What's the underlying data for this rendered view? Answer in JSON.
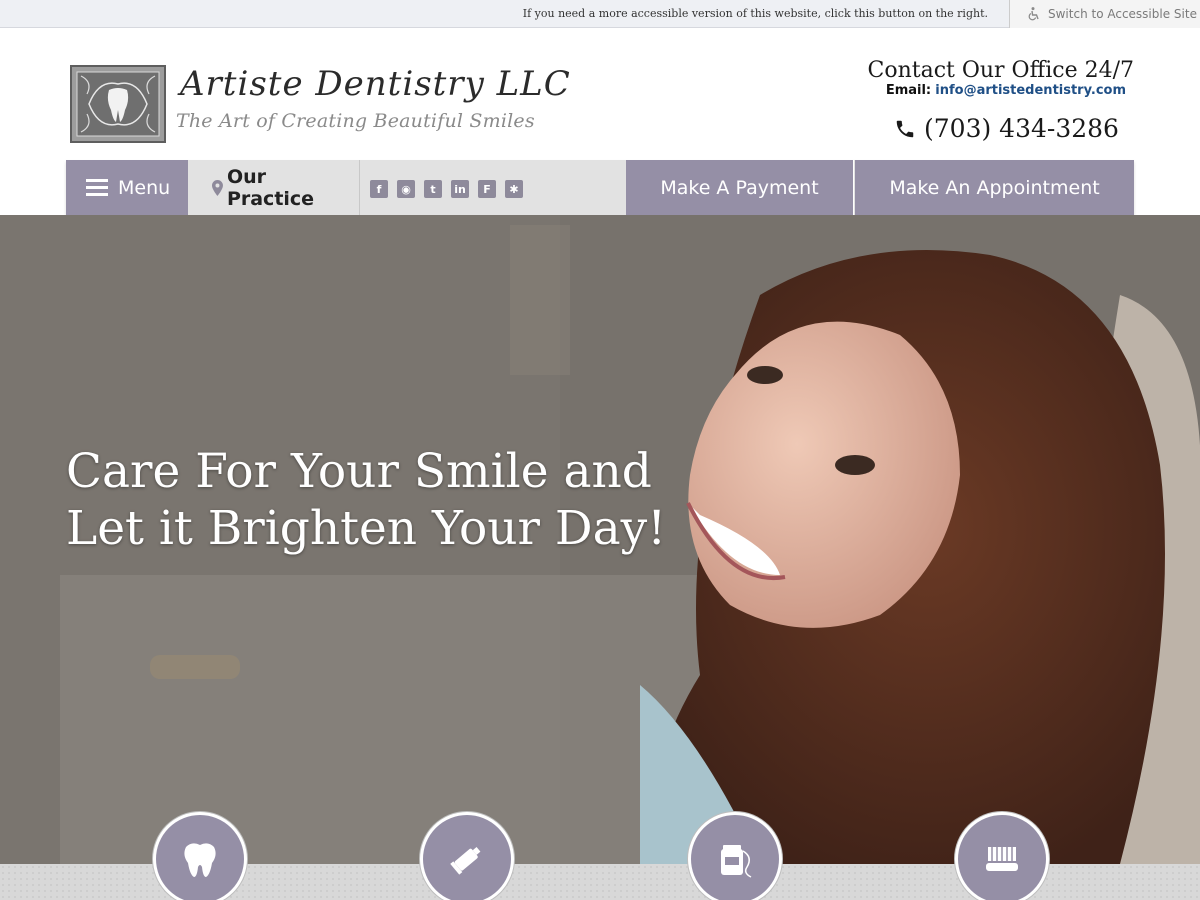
{
  "accessibility": {
    "note": "If you need a more accessible version of this website, click this button on the right.",
    "button_label": "Switch to Accessible Site",
    "icon": "wheelchair-icon"
  },
  "header": {
    "logo_name": "Artiste Dentistry LLC",
    "logo_tagline": "The Art of Creating Beautiful Smiles",
    "contact_heading": "Contact Our Office 24/7",
    "email_label": "Email:",
    "email": "info@artistedentistry.com",
    "phone": "(703) 434-3286"
  },
  "nav": {
    "menu_label": "Menu",
    "practice_label": "Our Practice",
    "social": [
      {
        "icon": "facebook-icon",
        "glyph": "f"
      },
      {
        "icon": "rss-icon",
        "glyph": "◉"
      },
      {
        "icon": "twitter-icon",
        "glyph": "t"
      },
      {
        "icon": "linkedin-icon",
        "glyph": "in"
      },
      {
        "icon": "foursquare-icon",
        "glyph": "F"
      },
      {
        "icon": "yelp-icon",
        "glyph": "✱"
      }
    ],
    "payment_label": "Make A Payment",
    "appointment_label": "Make An Appointment"
  },
  "hero": {
    "heading": "Care For Your Smile and Let it Brighten Your Day!"
  },
  "services": [
    {
      "icon": "tooth-icon"
    },
    {
      "icon": "toothpaste-icon"
    },
    {
      "icon": "floss-icon"
    },
    {
      "icon": "toothbrush-icon"
    }
  ],
  "colors": {
    "brand_purple": "#958fa6",
    "nav_gray": "#e2e2e2",
    "link_blue": "#1f4f86"
  }
}
